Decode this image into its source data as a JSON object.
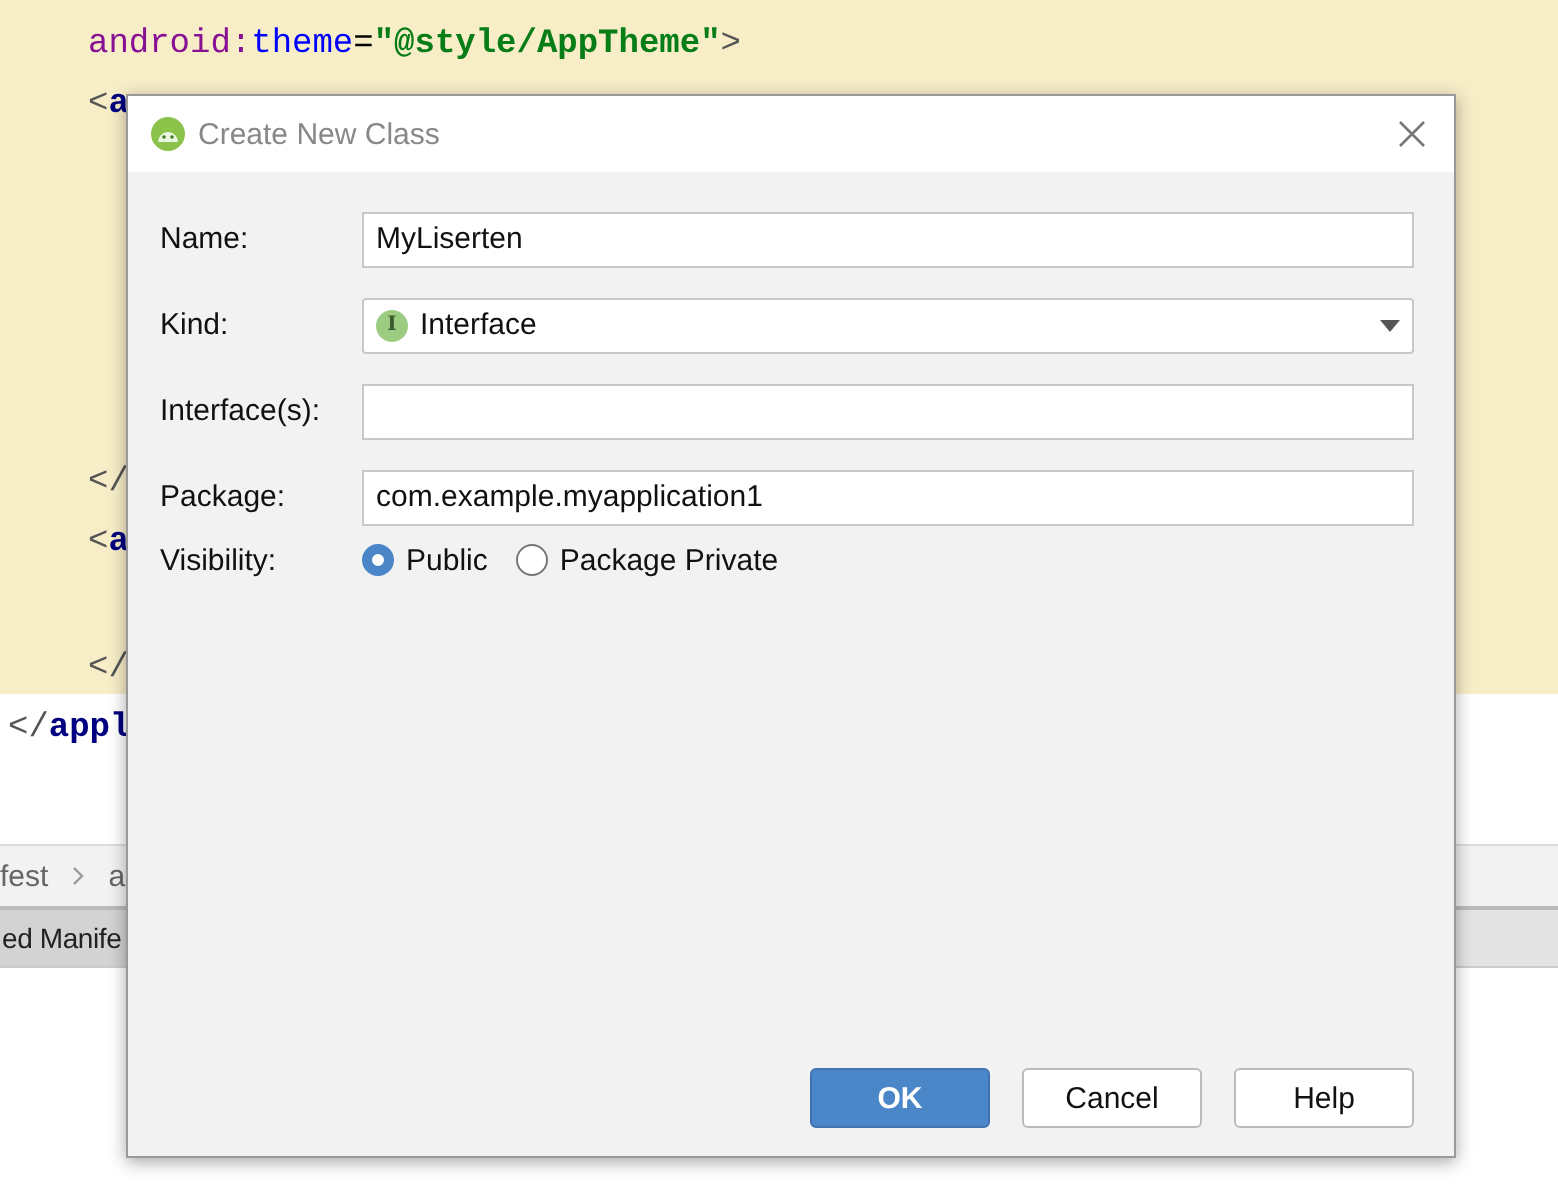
{
  "editor": {
    "top_lines": [
      {
        "segments": [
          {
            "kind": "attr_ns",
            "text": "android:"
          },
          {
            "kind": "attr",
            "text": "theme"
          },
          {
            "kind": "punct",
            "text": "="
          },
          {
            "kind": "value",
            "text": "\"@style/AppTheme\""
          },
          {
            "kind": "bracket",
            "text": ">"
          }
        ]
      },
      {
        "segments": [
          {
            "kind": "bracket",
            "text": "<"
          },
          {
            "kind": "tag",
            "text": "a"
          }
        ]
      }
    ],
    "bottom_lines": [
      {
        "segments": [
          {
            "kind": "bracket",
            "text": "</"
          }
        ]
      },
      {
        "segments": [
          {
            "kind": "bracket",
            "text": "<"
          },
          {
            "kind": "tag",
            "text": "a"
          }
        ]
      },
      {
        "segments": [
          {
            "kind": "bracket",
            "text": "</"
          }
        ]
      },
      {
        "segments": [
          {
            "kind": "bracket",
            "text": "</"
          },
          {
            "kind": "tag",
            "text": "appl"
          }
        ]
      }
    ],
    "breadcrumb": [
      "fest",
      "a"
    ],
    "tab": "ed Manife"
  },
  "dialog": {
    "title": "Create New Class",
    "fields": [
      {
        "kind": "text",
        "label": "Name:",
        "value": "MyLiserten"
      },
      {
        "kind": "dropdown",
        "label": "Kind:",
        "value": "Interface",
        "icon_letter": "I"
      },
      {
        "kind": "text",
        "label": "Interface(s):"
      },
      {
        "kind": "text",
        "label": "Package:",
        "value": "com.example.myapplication1"
      }
    ],
    "visibility": {
      "label": "Visibility:",
      "options": [
        {
          "label": "Public",
          "selected": true
        },
        {
          "label": "Package Private",
          "selected": false
        }
      ]
    },
    "buttons": [
      {
        "label": "OK",
        "kind": "primary"
      },
      {
        "label": "Cancel",
        "kind": "normal"
      },
      {
        "label": "Help",
        "kind": "normal"
      }
    ]
  }
}
